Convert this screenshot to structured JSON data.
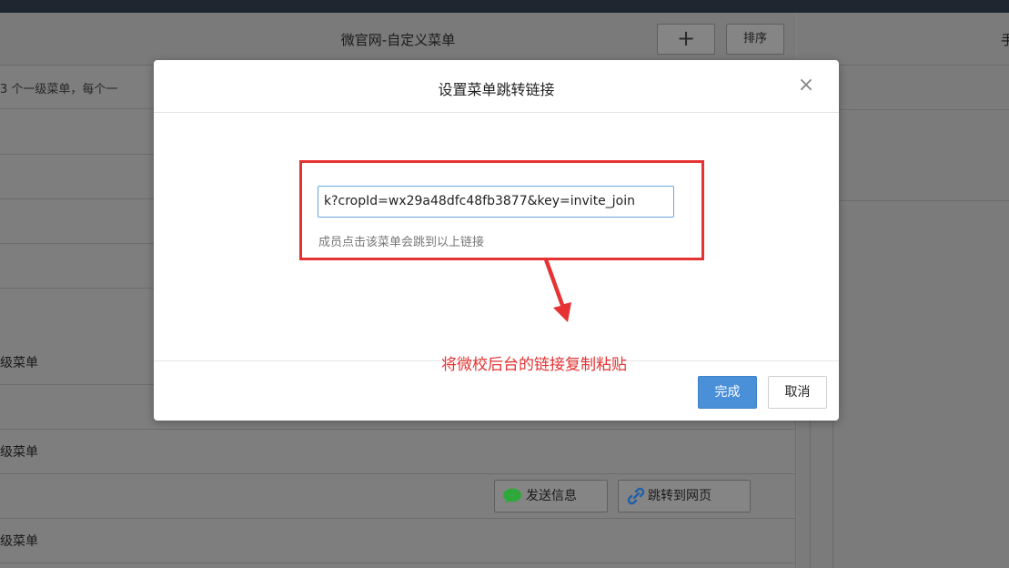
{
  "page": {
    "title": "微官网-自定义菜单",
    "add_label": "+",
    "sort_label": "排序",
    "hint": "3 个一级菜单，每个一",
    "rows": [
      {
        "label": ""
      },
      {
        "label": ""
      },
      {
        "label": ""
      },
      {
        "label": ""
      },
      {
        "label": "级菜单"
      },
      {
        "label": ""
      },
      {
        "label": "级菜单"
      },
      {
        "label": ""
      },
      {
        "label": "级菜单"
      }
    ],
    "send_message_label": "发送信息",
    "jump_page_label": "跳转到网页",
    "right_header": "手"
  },
  "modal": {
    "title": "设置菜单跳转链接",
    "close_glyph": "×",
    "url_value": "k?cropId=wx29a48dfc48fb3877&key=invite_join",
    "url_hint": "成员点击该菜单会跳到以上链接",
    "done_label": "完成",
    "cancel_label": "取消"
  },
  "annotation": {
    "text": "将微校后台的链接复制粘贴",
    "color": "#e53333"
  },
  "colors": {
    "accent": "#4a90d9",
    "annotation_red": "#e53333",
    "wechat_green": "#2fa83b"
  }
}
